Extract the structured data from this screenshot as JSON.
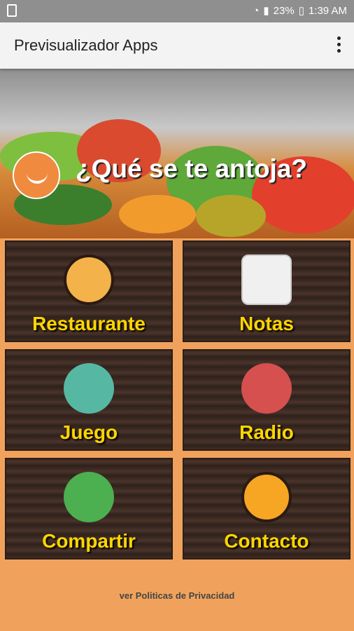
{
  "status": {
    "battery": "23%",
    "time": "1:39 AM"
  },
  "appbar": {
    "title": "Previsualizador Apps"
  },
  "hero": {
    "heading": "¿Qué se te antoja?"
  },
  "tiles": [
    {
      "label": "Restaurante",
      "icon": "pizza-icon",
      "color": "#f4b24a"
    },
    {
      "label": "Notas",
      "icon": "notes-icon",
      "color": "#f0f0f0"
    },
    {
      "label": "Juego",
      "icon": "gamepad-icon",
      "color": "#56b8a3"
    },
    {
      "label": "Radio",
      "icon": "radio-icon",
      "color": "#d5504f"
    },
    {
      "label": "Compartir",
      "icon": "share-icon",
      "color": "#4caf50"
    },
    {
      "label": "Contacto",
      "icon": "mail-icon",
      "color": "#f6a623"
    }
  ],
  "footer": {
    "link": "ver Politicas de Privacidad"
  }
}
